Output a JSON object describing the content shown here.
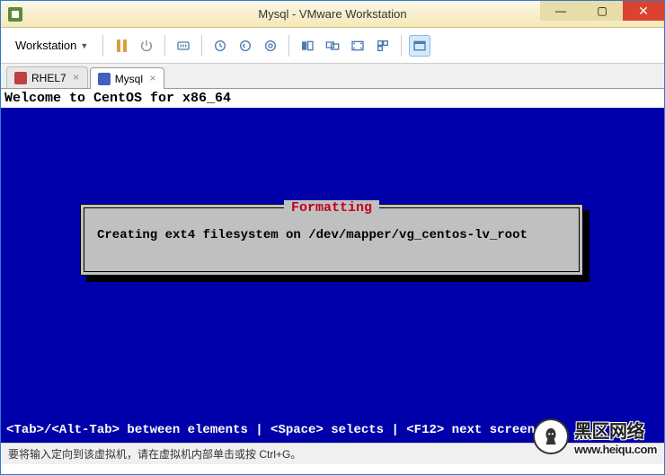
{
  "window": {
    "title": "Mysql - VMware Workstation",
    "controls": {
      "min": "—",
      "max": "▢",
      "close": "✕"
    }
  },
  "toolbar": {
    "menu_label": "Workstation"
  },
  "tabs": [
    {
      "label": "RHEL7",
      "active": false
    },
    {
      "label": "Mysql",
      "active": true
    }
  ],
  "console": {
    "header": "Welcome to CentOS for x86_64",
    "dialog_title": "Formatting",
    "dialog_body": "Creating ext4 filesystem on /dev/mapper/vg_centos-lv_root",
    "footer": "<Tab>/<Alt-Tab> between elements   |   <Space> selects   |  <F12> next screen"
  },
  "statusbar": {
    "hint": "要将输入定向到该虚拟机，请在虚拟机内部单击或按 Ctrl+G。"
  },
  "watermark": {
    "text1": "黑区网络",
    "text2": "www.heiqu.com"
  }
}
